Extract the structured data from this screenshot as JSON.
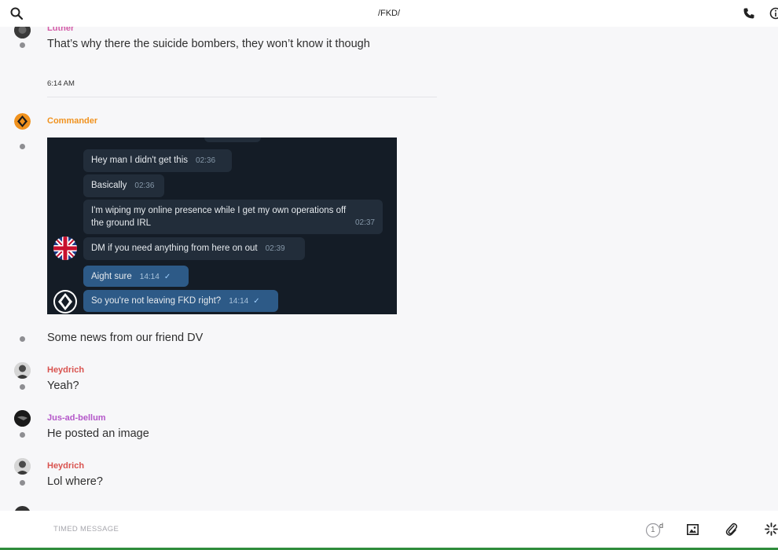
{
  "header": {
    "title": "/FKD/"
  },
  "messages": {
    "m1_author": "Luther",
    "m1_text": "That’s why there the suicide bombers, they won’t know it though",
    "separator_time": "6:14 AM",
    "m2_author": "Commander",
    "m3_text": "Some news from our friend DV",
    "m4_author": "Heydrich",
    "m4_text": "Yeah?",
    "m5_author": "Jus-ad-bellum",
    "m5_text": "He posted an image",
    "m6_author": "Heydrich",
    "m6_text": "Lol where?"
  },
  "screenshot": {
    "b1": {
      "text": "Hey man I didn't get this",
      "time": "02:36"
    },
    "b2": {
      "text": "Basically",
      "time": "02:36"
    },
    "b3": {
      "text1": "I'm wiping my online presence while I get my own operations off",
      "text2": "the ground IRL",
      "time": "02:37"
    },
    "b4": {
      "text": "DM if you need anything from here on out",
      "time": "02:39"
    },
    "b5": {
      "text": "Aight sure",
      "time": "14:14"
    },
    "b6": {
      "text": "So you're not leaving FKD right?",
      "time": "14:14"
    }
  },
  "composer": {
    "placeholder": "TIMED MESSAGE",
    "timer_value": "1",
    "timer_unit": "d"
  },
  "colors": {
    "luther": "#d45ca8",
    "commander": "#f0921e",
    "heydrich": "#d9534f",
    "jus": "#b457c9",
    "outgoing_bubble": "#2d5a87",
    "bottom_accent": "#2f8c3c"
  },
  "icons": {
    "search": "search-icon",
    "call": "phone-icon",
    "info": "info-icon",
    "timer": "timer-icon",
    "image": "image-icon",
    "attach": "paperclip-icon",
    "more": "sparkle-icon"
  }
}
